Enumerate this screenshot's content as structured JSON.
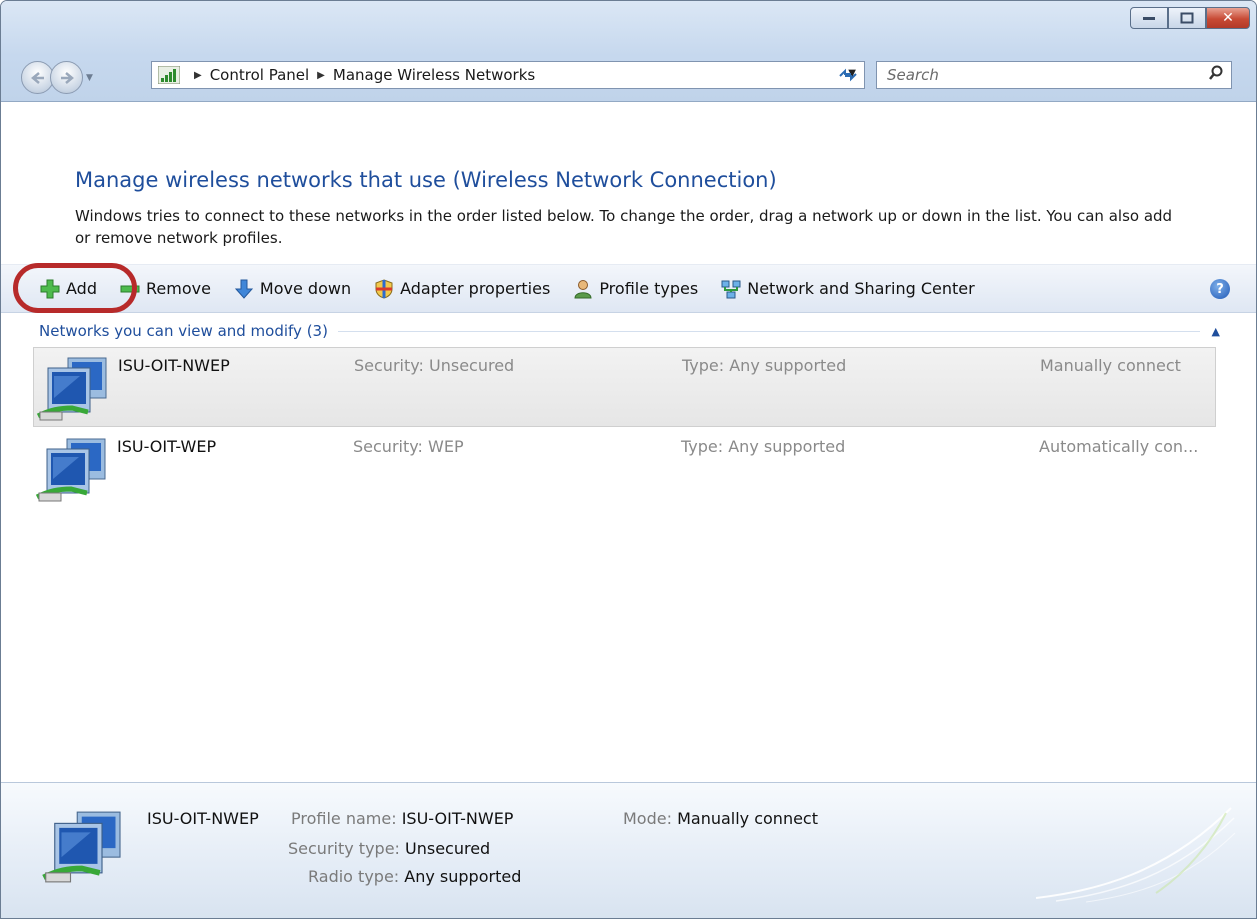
{
  "window": {
    "caption": {
      "minimize": "–",
      "maximize": "▢",
      "close": "✕"
    }
  },
  "addressbar": {
    "crumbs": [
      "Control Panel",
      "Manage Wireless Networks"
    ],
    "search_placeholder": "Search"
  },
  "page": {
    "heading": "Manage wireless networks that use (Wireless Network Connection)",
    "description": "Windows tries to connect to these networks in the order listed below. To change the order, drag a network up or down in the list. You can also add or remove network profiles."
  },
  "toolbar": {
    "add": "Add",
    "remove": "Remove",
    "move_down": "Move down",
    "adapter_properties": "Adapter properties",
    "profile_types": "Profile types",
    "network_sharing": "Network and Sharing Center",
    "help": "?"
  },
  "group": {
    "label": "Networks you can view and modify (3)"
  },
  "networks": [
    {
      "name": "ISU-OIT-NWEP",
      "security": "Security: Unsecured",
      "type": "Type: Any supported",
      "mode": "Manually connect",
      "selected": true
    },
    {
      "name": "ISU-OIT-WEP",
      "security": "Security: WEP",
      "type": "Type: Any supported",
      "mode": "Automatically con...",
      "selected": false
    }
  ],
  "details": {
    "name": "ISU-OIT-NWEP",
    "profile_name_label": "Profile name:",
    "profile_name": "ISU-OIT-NWEP",
    "security_type_label": "Security type:",
    "security_type": "Unsecured",
    "radio_type_label": "Radio type:",
    "radio_type": "Any supported",
    "mode_label": "Mode:",
    "mode": "Manually connect"
  },
  "colors": {
    "accent_link": "#1f4e9c",
    "highlight_ring": "#b72a2a"
  }
}
